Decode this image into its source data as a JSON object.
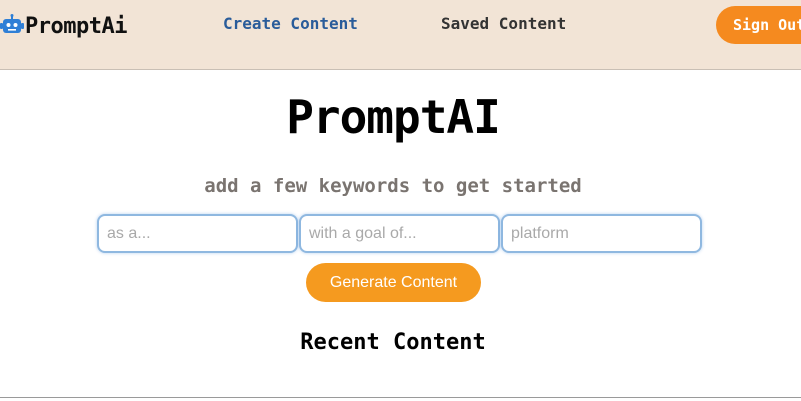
{
  "nav": {
    "brand": "PromptAi",
    "brand_icon": "robot-icon",
    "links": [
      {
        "label": "Create Content",
        "active": true
      },
      {
        "label": "Saved Content",
        "active": false
      }
    ],
    "signout_label": "Sign Out"
  },
  "main": {
    "title": "PromptAI",
    "subtitle": "add a few keywords to get started",
    "inputs": [
      {
        "placeholder": "as a...",
        "value": ""
      },
      {
        "placeholder": "with a goal of...",
        "value": ""
      },
      {
        "placeholder": "platform",
        "value": ""
      }
    ],
    "generate_label": "Generate Content",
    "recent_title": "Recent Content"
  },
  "colors": {
    "navbar_bg": "#f2e4d6",
    "accent": "#f59a1f",
    "link_active": "#2a5c9a",
    "input_border": "#8fb8e0",
    "icon_blue": "#2f7fd6"
  }
}
